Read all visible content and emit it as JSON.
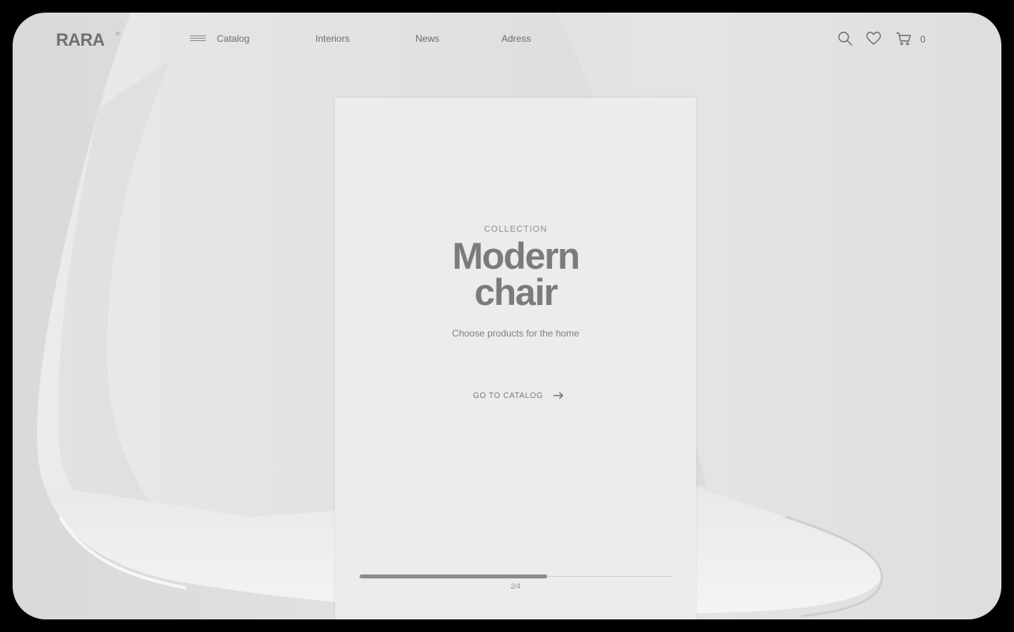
{
  "brand": {
    "name": "RARA",
    "registered_mark": "®"
  },
  "nav": {
    "items": [
      {
        "label": "Catalog",
        "icon": "menu-icon"
      },
      {
        "label": "Interiors"
      },
      {
        "label": "News"
      },
      {
        "label": "Adress"
      }
    ]
  },
  "header_actions": {
    "search_icon": "search-icon",
    "favorites_icon": "heart-icon",
    "cart_icon": "cart-icon",
    "cart_count": "0"
  },
  "hero": {
    "kicker": "COLLECTION",
    "title_line1": "Modern",
    "title_line2": "chair",
    "subtitle": "Choose products for the home",
    "cta_label": "GO TO CATALOG",
    "cta_icon": "arrow-right-icon"
  },
  "slider": {
    "current": 2,
    "total": 4,
    "counter_text": "2/4",
    "progress_fraction": 0.6
  },
  "colors": {
    "background": "#e0e0df",
    "card": "#ececec",
    "text": "#7b7b7b",
    "progress_fill": "#8c8c8c"
  }
}
